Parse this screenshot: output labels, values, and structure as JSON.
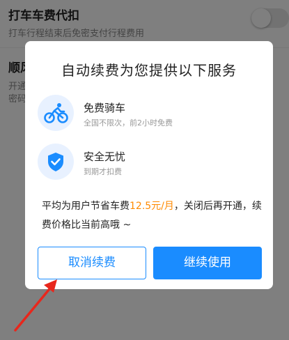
{
  "background": {
    "row1": {
      "title": "打车车费代扣",
      "description": "打车行程结束后免密支付行程费用"
    },
    "row2": {
      "title": "顺风",
      "desc_line1": "开通",
      "desc_line2": "密码"
    }
  },
  "dialog": {
    "title": "自动续费为您提供以下服务",
    "features": [
      {
        "name": "免费骑车",
        "description": "全国不限次，前2小时免费",
        "icon": "bicycle-icon"
      },
      {
        "name": "安全无忧",
        "description": "到期才扣费",
        "icon": "shield-check-icon"
      }
    ],
    "notice": {
      "before": "平均为用户节省车费",
      "price": "12.5元/月",
      "after": "，关闭后再开通，续费价格比当前高哦 ~"
    },
    "buttons": {
      "cancel": "取消续费",
      "continue": "继续使用"
    }
  },
  "colors": {
    "accent": "#1a8cff",
    "price": "#ff8a00",
    "annotation": "#e8271c"
  }
}
